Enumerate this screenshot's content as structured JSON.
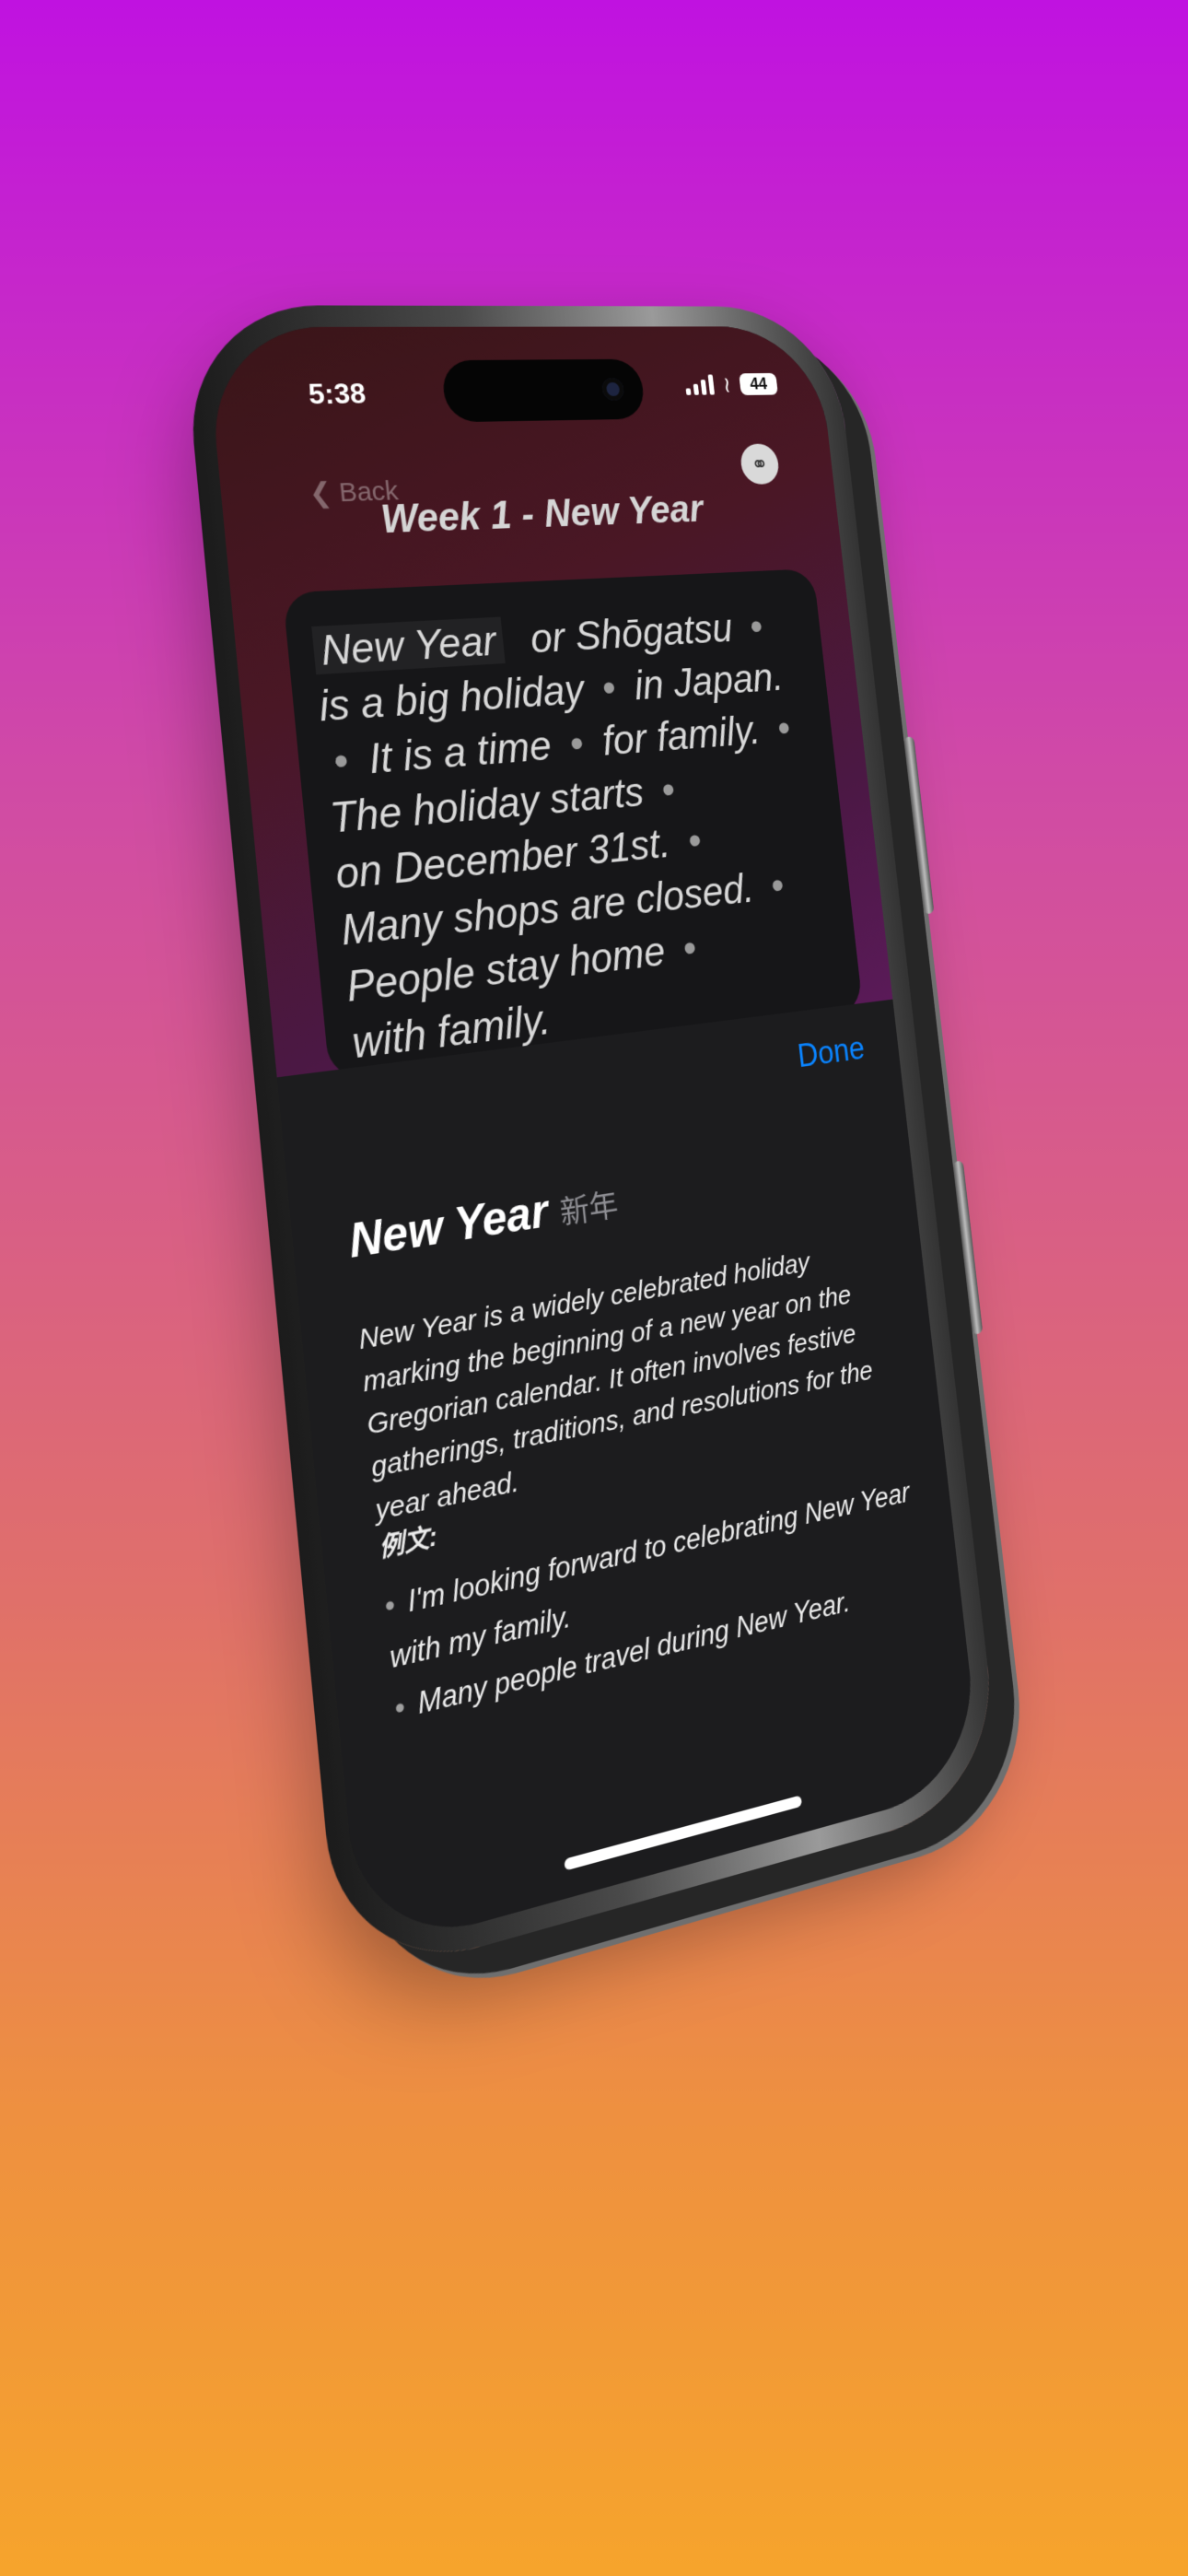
{
  "status_bar": {
    "time": "5:38",
    "battery": "44"
  },
  "nav": {
    "back_label": "Back",
    "title": "Week 1 - New Year"
  },
  "reader": {
    "highlighted_word": "New Year",
    "segments": [
      "or Shōgatsu",
      "is a big holiday",
      "in Japan.",
      "It is a time",
      "for family.",
      "The holiday starts",
      "on December 31st.",
      "Many shops are closed.",
      "People stay home",
      "with family."
    ]
  },
  "sheet": {
    "done_label": "Done",
    "word": "New Year",
    "word_japanese": "新年",
    "definition": "New Year is a widely celebrated holiday marking the beginning of a new year on the Gregorian calendar. It often involves festive gatherings, traditions, and resolutions for the year ahead.",
    "examples_label": "例文:",
    "examples": [
      "I'm looking forward to celebrating New Year with my family.",
      "Many people travel during New Year."
    ]
  },
  "icons": [
    "signal-icon",
    "wifi-icon",
    "battery-icon",
    "back-chevron-icon",
    "headphones-icon"
  ]
}
